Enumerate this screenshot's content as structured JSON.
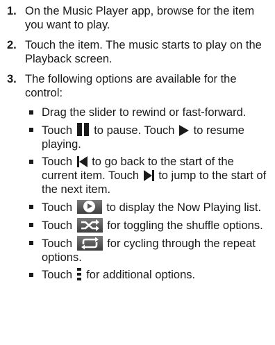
{
  "steps": [
    {
      "number": "1.",
      "text": "On the Music Player app, browse for the item you want to play."
    },
    {
      "number": "2.",
      "text": "Touch the item. The music starts to play on the Playback screen."
    },
    {
      "number": "3.",
      "text": "The following options are available for the control:",
      "options": {
        "drag_slider": "Drag the slider to rewind or fast-forward.",
        "pause": {
          "before": "Touch",
          "icon": "pause-icon",
          "middle": "to pause. Touch",
          "icon2": "play-icon",
          "after": "to resume playing."
        },
        "prev_next": {
          "before": "Touch",
          "icon": "previous-icon",
          "middle": "to go back to the start of the current item. Touch",
          "icon2": "next-icon",
          "after": "to jump to the start of the next item."
        },
        "now_playing": {
          "before": "Touch",
          "icon": "now-playing-icon",
          "after": "to display the Now Playing list."
        },
        "shuffle": {
          "before": "Touch",
          "icon": "shuffle-icon",
          "after": "for toggling the shuffle options."
        },
        "repeat": {
          "before": "Touch",
          "icon": "repeat-icon",
          "after": "for cycling through the repeat options."
        },
        "menu": {
          "before": "Touch",
          "icon": "menu-icon",
          "after": "for additional options."
        }
      }
    }
  ],
  "colors": {
    "text": "#1a1a1a",
    "icon_box_top": "#7a7a7a",
    "icon_box_bottom": "#3e3e3e"
  }
}
